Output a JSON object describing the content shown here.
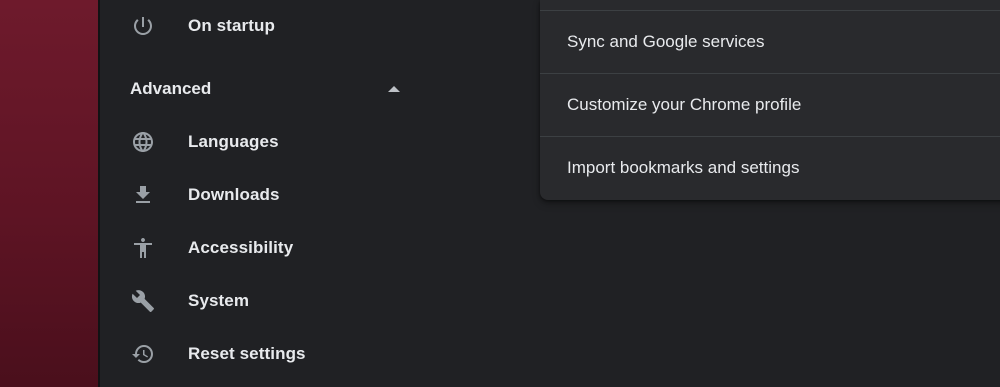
{
  "sidebar": {
    "items_top": [
      {
        "label": "On startup",
        "icon": "power-icon"
      }
    ],
    "advanced": {
      "label": "Advanced",
      "expanded": true,
      "caret_icon": "caret-up-icon"
    },
    "items_advanced": [
      {
        "label": "Languages",
        "icon": "globe-icon"
      },
      {
        "label": "Downloads",
        "icon": "download-icon"
      },
      {
        "label": "Accessibility",
        "icon": "accessibility-icon"
      },
      {
        "label": "System",
        "icon": "wrench-icon"
      },
      {
        "label": "Reset settings",
        "icon": "restore-history-icon"
      }
    ]
  },
  "you_and_google_card": {
    "rows": [
      {
        "label": "Sync and Google services"
      },
      {
        "label": "Customize your Chrome profile"
      },
      {
        "label": "Import bookmarks and settings"
      }
    ]
  },
  "colors": {
    "background": "#202124",
    "card": "#292a2d",
    "text": "#e8eaed",
    "icon": "#9aa0a6",
    "divider": "#3c4043",
    "desktop_wallpaper": "#6e1a2c"
  }
}
